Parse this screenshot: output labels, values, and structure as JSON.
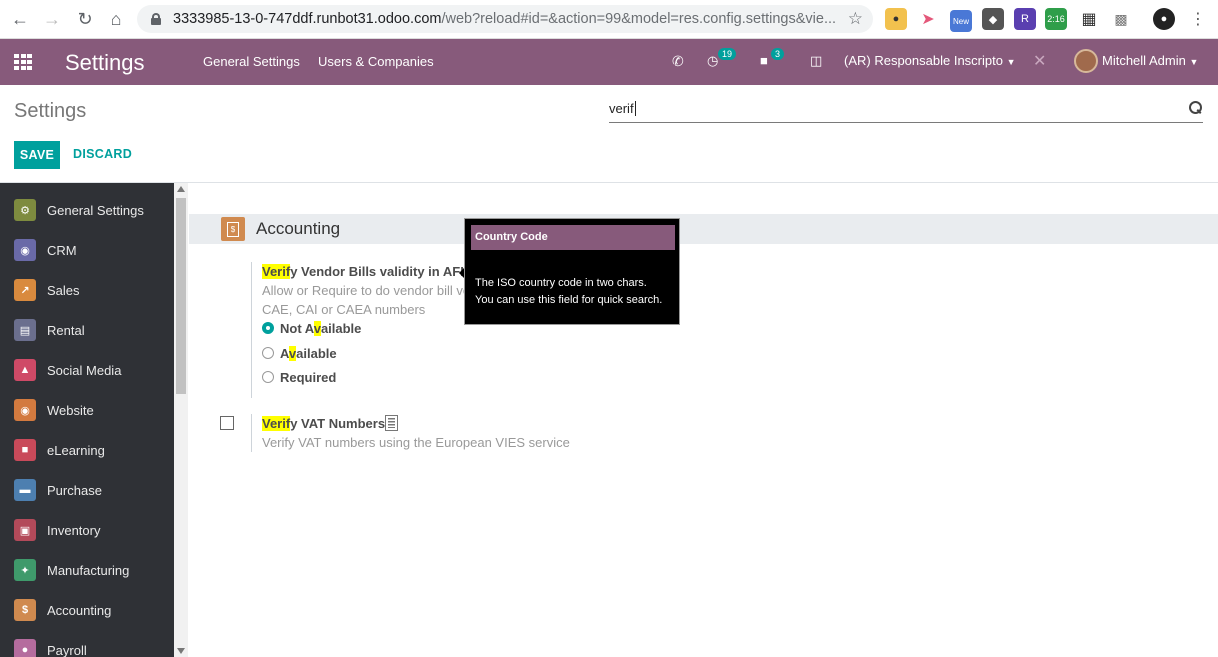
{
  "browser": {
    "url_main": "3333985-13-0-747ddf.runbot31.odoo.com",
    "url_rest": "/web?reload#id=&action=99&model=res.config.settings&vie...",
    "ext_new_badge": "New",
    "ext_time_badge": "2:16"
  },
  "navbar": {
    "brand": "Settings",
    "menu": [
      "General Settings",
      "Users & Companies"
    ],
    "activity_count": "19",
    "messages_count": "3",
    "company": "(AR) Responsable Inscripto",
    "user": "Mitchell Admin"
  },
  "control_panel": {
    "title": "Settings",
    "search_value": "verif",
    "save_label": "SAVE",
    "discard_label": "DISCARD"
  },
  "sidebar": {
    "items": [
      {
        "label": "General Settings",
        "icon": "gear-icon",
        "color": "#7e8b3f"
      },
      {
        "label": "CRM",
        "icon": "crm-icon",
        "color": "#6a6aa8"
      },
      {
        "label": "Sales",
        "icon": "sales-chart-icon",
        "color": "#d98a3e"
      },
      {
        "label": "Rental",
        "icon": "rental-icon",
        "color": "#6b6f8e"
      },
      {
        "label": "Social Media",
        "icon": "thumbs-up-icon",
        "color": "#cf4a67"
      },
      {
        "label": "Website",
        "icon": "globe-icon",
        "color": "#d37a3f"
      },
      {
        "label": "eLearning",
        "icon": "elearning-icon",
        "color": "#c94a5a"
      },
      {
        "label": "Purchase",
        "icon": "purchase-card-icon",
        "color": "#4d7fb0"
      },
      {
        "label": "Inventory",
        "icon": "inventory-box-icon",
        "color": "#b34a5a"
      },
      {
        "label": "Manufacturing",
        "icon": "wrench-icon",
        "color": "#3f9a6b"
      },
      {
        "label": "Accounting",
        "icon": "accounting-doc-icon",
        "color": "#d08a4f"
      },
      {
        "label": "Payroll",
        "icon": "payroll-icon",
        "color": "#b56c9e"
      }
    ]
  },
  "content": {
    "section_title": "Accounting",
    "afip_setting": {
      "title_highlight": "Verif",
      "title_rest": "y Vendor Bills validity in AFIP",
      "desc_line1": "Allow or Require to do vendor bill ve",
      "desc_line2": "CAE, CAI or CAEA numbers",
      "options": [
        {
          "pre": "Not A",
          "hl": "v",
          "post": "ailable",
          "checked": true
        },
        {
          "pre": "A",
          "hl": "v",
          "post": "ailable",
          "checked": false
        },
        {
          "pre": "Required",
          "hl": "",
          "post": "",
          "checked": false
        }
      ]
    },
    "vat_setting": {
      "title_highlight": "Verif",
      "title_rest": "y VAT Numbers",
      "desc": "Verify VAT numbers using the European VIES service"
    }
  },
  "tooltip": {
    "title": "Country Code",
    "line1": "The ISO country code in two chars.",
    "line2": "You can use this field for quick search."
  }
}
